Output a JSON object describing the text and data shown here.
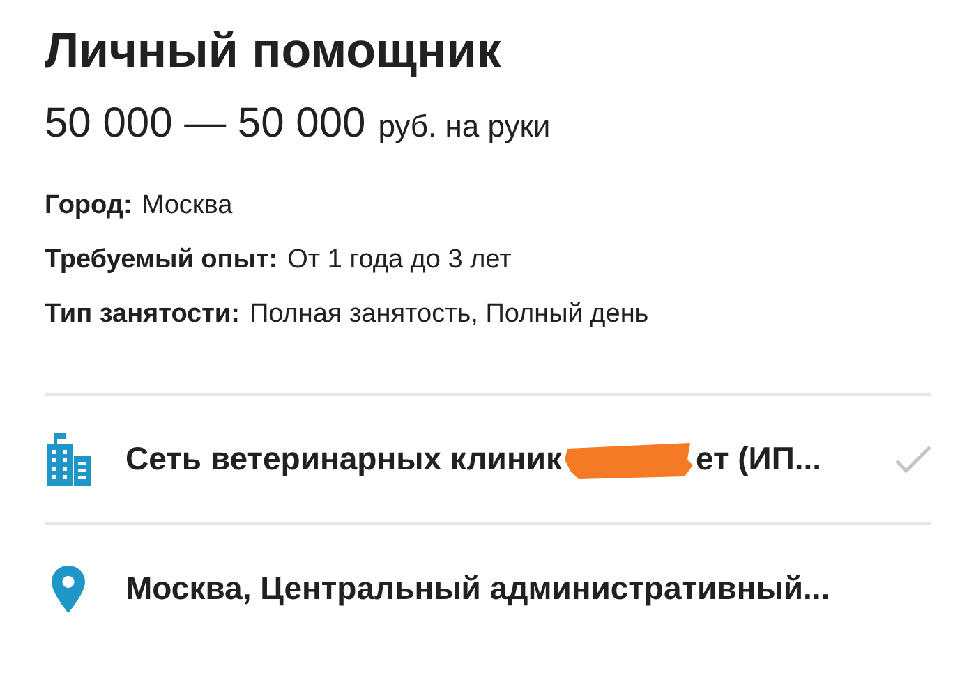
{
  "vacancy": {
    "title": "Личный помощник",
    "salary": {
      "amount": "50 000 — 50 000",
      "suffix": "руб. на руки"
    }
  },
  "details": [
    {
      "label": "Город:",
      "value": "Москва"
    },
    {
      "label": "Требуемый опыт:",
      "value": "От 1 года до 3 лет"
    },
    {
      "label": "Тип занятости:",
      "value": "Полная занятость, Полный день"
    }
  ],
  "company": {
    "name_before": "Сеть ветеринарных клиник",
    "name_after": "ет (ИП...",
    "redacted": true
  },
  "address": {
    "text": "Москва, Центральный административный..."
  }
}
